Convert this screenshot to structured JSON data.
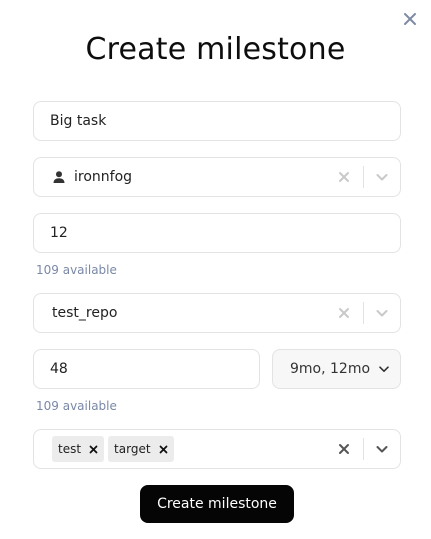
{
  "dialog": {
    "title": "Create milestone"
  },
  "form": {
    "name_value": "Big task",
    "owner_value": "ironnfog",
    "amount_value": "12",
    "amount_helper": "109 available",
    "repo_value": "test_repo",
    "duration_value": "48",
    "duration_helper": "109 available",
    "duration_unit": "9mo, 12mo",
    "tags": [
      "test",
      "target"
    ]
  },
  "actions": {
    "submit_label": "Create milestone"
  },
  "icons": {
    "close": "close-icon",
    "user": "user-icon",
    "clear": "clear-icon",
    "chevron": "chevron-down-icon",
    "remove": "remove-chip-icon"
  },
  "colors": {
    "primary_button": "#050505",
    "helper_text": "#7a88a8",
    "border": "#e3e3e3"
  }
}
